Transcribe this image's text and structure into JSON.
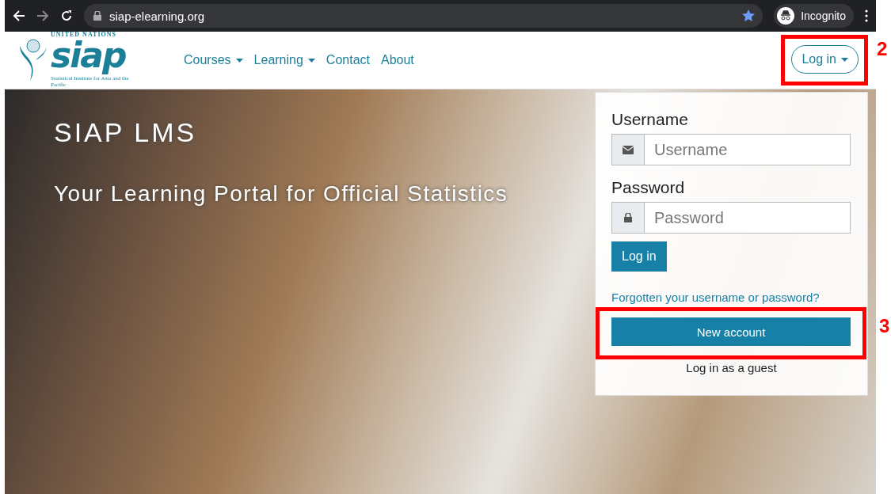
{
  "browser": {
    "url": "siap-elearning.org",
    "profile": "Incognito"
  },
  "header": {
    "logo": {
      "top": "UNITED NATIONS",
      "name": "siap",
      "subtitle": "Statistical Institute for Asia and the Pacific"
    },
    "nav": [
      {
        "label": "Courses",
        "dropdown": true
      },
      {
        "label": "Learning",
        "dropdown": true
      },
      {
        "label": "Contact",
        "dropdown": false
      },
      {
        "label": "About",
        "dropdown": false
      }
    ],
    "login_button": "Log in"
  },
  "hero": {
    "title": "SIAP LMS",
    "tagline": "Your Learning Portal for Official Statistics"
  },
  "login_form": {
    "username_label": "Username",
    "username_placeholder": "Username",
    "password_label": "Password",
    "password_placeholder": "Password",
    "submit": "Log in",
    "forgot_link": "Forgotten your username or password?",
    "new_account": "New account",
    "guest_link": "Log in as a guest"
  },
  "annotations": {
    "login_button": "2",
    "new_account": "3"
  }
}
